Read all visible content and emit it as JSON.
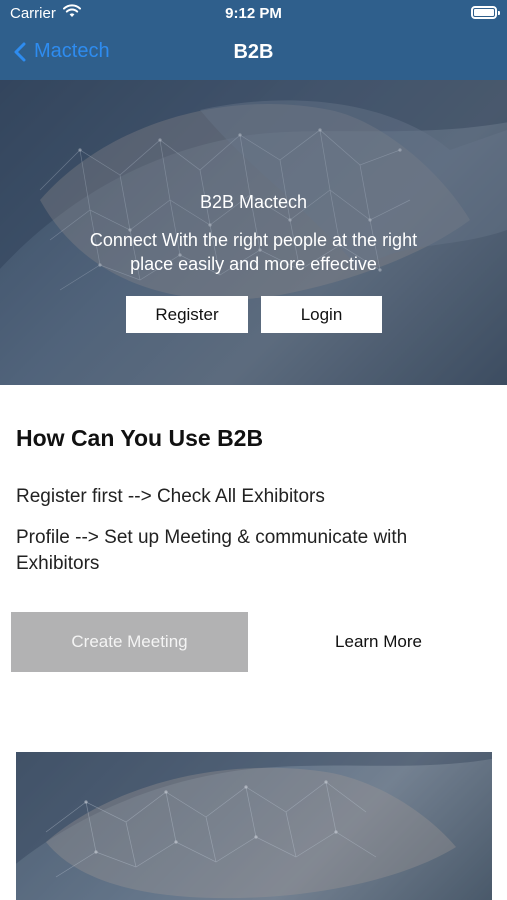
{
  "status_bar": {
    "carrier": "Carrier",
    "time": "9:12 PM"
  },
  "nav": {
    "back_label": "Mactech",
    "title": "B2B"
  },
  "hero": {
    "subtitle": "B2B Mactech",
    "tagline": "Connect With the right people at the right place easily and more effective",
    "register_label": "Register",
    "login_label": "Login"
  },
  "info": {
    "title": "How Can You Use B2B",
    "step1": "Register first --> Check All Exhibitors",
    "step2": "Profile --> Set up Meeting & communicate with Exhibitors"
  },
  "actions": {
    "create_meeting_label": "Create Meeting",
    "learn_more_label": "Learn More"
  },
  "colors": {
    "nav_background": "#2f5f8c",
    "link_blue": "#2e8cf0",
    "disabled_button": "#b2b2b3"
  },
  "icons": {
    "back": "chevron-left-icon",
    "wifi": "wifi-icon",
    "battery": "battery-icon"
  }
}
